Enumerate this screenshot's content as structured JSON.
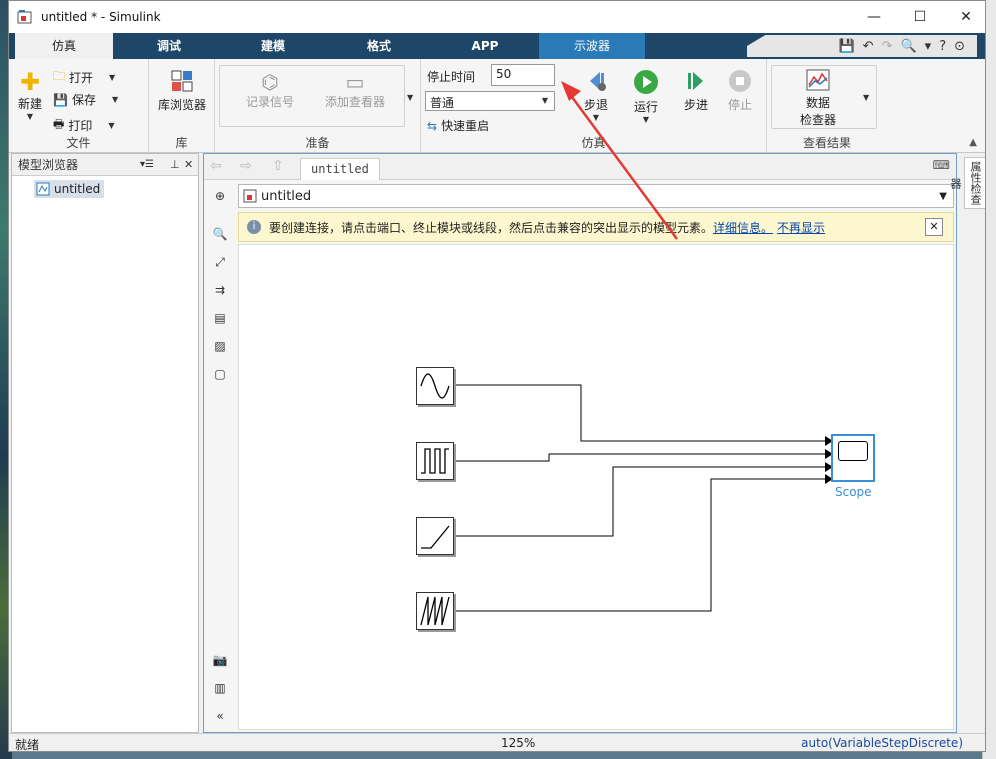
{
  "window": {
    "title": "untitled * - Simulink"
  },
  "tabs": [
    "仿真",
    "调试",
    "建模",
    "格式",
    "APP",
    "示波器"
  ],
  "ribbon": {
    "file": {
      "new": "新建",
      "open": "打开",
      "save": "保存",
      "print": "打印",
      "label": "文件"
    },
    "library": {
      "browser": "库浏览器",
      "label": "库"
    },
    "prepare": {
      "log_signals": "记录信号",
      "add_viewer": "添加查看器",
      "label": "准备"
    },
    "simulate": {
      "stop_time_label": "停止时间",
      "stop_time": "50",
      "mode": "普通",
      "fast_restart": "快速重启",
      "step_back": "步退",
      "run": "运行",
      "step_forward": "步进",
      "stop": "停止",
      "label": "仿真"
    },
    "review": {
      "data_inspector_1": "数据",
      "data_inspector_2": "检查器",
      "label": "查看结果"
    }
  },
  "model_browser": {
    "header": "模型浏览器",
    "item": "untitled"
  },
  "editor": {
    "tab": "untitled",
    "address": "untitled",
    "banner_text": "要创建连接，请点击端口、终止模块或线段，然后点击兼容的突出显示的模型元素。",
    "banner_link1": "详细信息。",
    "banner_link2": "不再显示",
    "scope_label": "Scope"
  },
  "property_inspector": "属性检查器",
  "status": {
    "left": "就绪",
    "zoom": "125%",
    "solver": "auto(VariableStepDiscrete)"
  },
  "colors": {
    "tabbar": "#1e4668",
    "scope_tab": "#2a7ab8",
    "annotation_arrow": "#e53935",
    "selection": "#3a8fd6"
  }
}
